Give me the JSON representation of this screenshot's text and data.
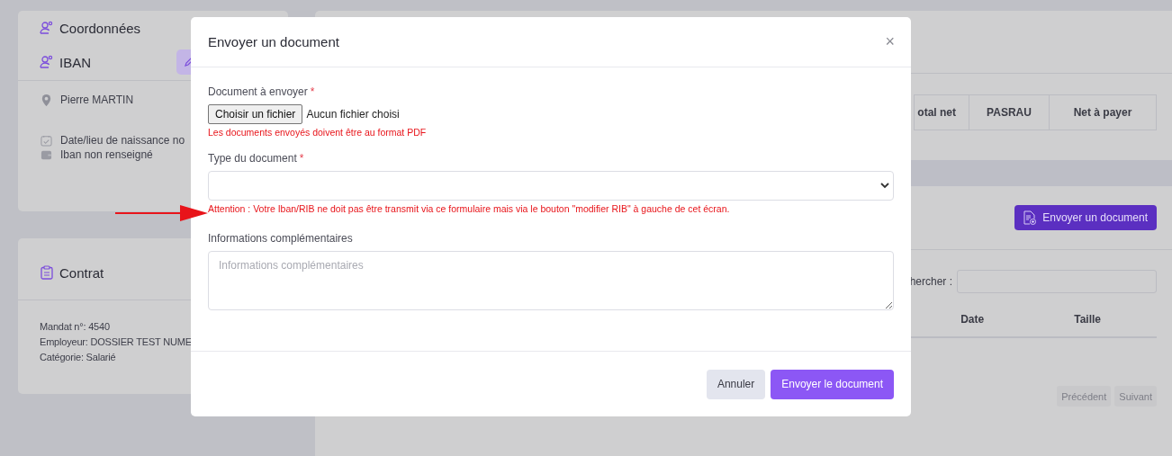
{
  "coordinates_card": {
    "title": "Coordonnées",
    "iban_title": "IBAN",
    "name": "Pierre MARTIN",
    "birth": "Date/lieu de naissance no",
    "iban_status": "Iban non renseigné"
  },
  "contract_card": {
    "title": "Contrat",
    "lines": [
      "Mandat n°: 4540",
      "Employeur: DOSSIER TEST NUME",
      "Catégorie: Salarié"
    ]
  },
  "payslip_table": {
    "columns": [
      "otal net",
      "PASRAU",
      "Net à payer"
    ]
  },
  "documents": {
    "send_button": "Envoyer un document",
    "search_label": "hercher :",
    "columns": [
      "Date",
      "Taille"
    ],
    "pagination": [
      {
        "label": "Précédent",
        "disabled": true
      },
      {
        "label": "Suivant",
        "disabled": true
      }
    ]
  },
  "modal": {
    "title": "Envoyer un document",
    "close": "×",
    "fields": [
      {
        "kind": "file",
        "label": "Document à envoyer",
        "required_mark": "*",
        "button": "Choisir un fichier",
        "status": "Aucun fichier choisi",
        "hint": "Les documents envoyés doivent être au format PDF"
      },
      {
        "kind": "select",
        "label": "Type du document",
        "required_mark": "*",
        "hint": "Attention : Votre Iban/RIB ne doit pas être transmit via ce formulaire mais via le bouton \"modifier RIB\" à gauche de cet écran."
      },
      {
        "kind": "textarea",
        "label": "Informations complémentaires",
        "placeholder": "Informations complémentaires"
      }
    ],
    "buttons": [
      {
        "label": "Annuler",
        "kind": "secondary"
      },
      {
        "label": "Envoyer le document",
        "kind": "primary"
      }
    ]
  }
}
